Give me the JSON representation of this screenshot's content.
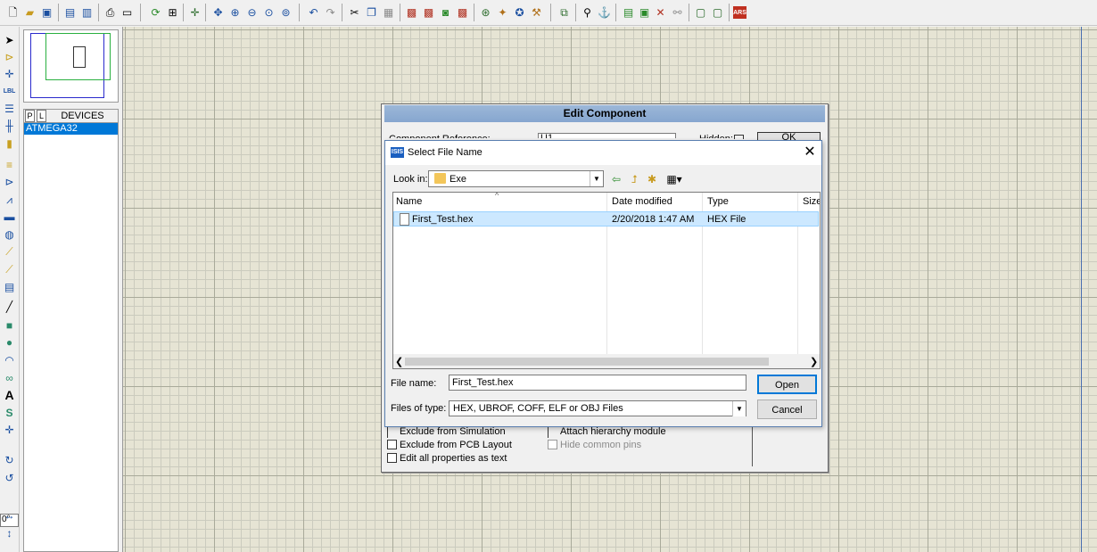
{
  "toolbar": {
    "icons": [
      "new-file-icon",
      "open-folder-icon",
      "save-icon",
      "import-section-icon",
      "export-section-icon",
      "print-icon",
      "print-area-icon",
      "refresh-icon",
      "grid-toggle-icon",
      "origin-icon",
      "pan-icon",
      "zoom-in-icon",
      "zoom-out-icon",
      "zoom-all-icon",
      "zoom-area-icon",
      "undo-icon",
      "redo-icon",
      "cut-icon",
      "copy-icon",
      "paste-icon",
      "block-copy-icon",
      "block-move-icon",
      "block-rotate-icon",
      "block-delete-icon",
      "pick-device-icon",
      "make-device-icon",
      "packaging-tool-icon",
      "decompose-icon",
      "wire-autorouter-icon",
      "search-tag-icon",
      "property-tool-icon",
      "new-sheet-icon",
      "remove-sheet-icon",
      "exit-parent-icon",
      "view-bom-icon",
      "electrical-rules-icon",
      "netlist-to-ares-icon"
    ]
  },
  "left_tools": {
    "icons": [
      "selection-mode-icon",
      "component-mode-icon",
      "junction-dot-icon",
      "wire-label-icon",
      "text-script-icon",
      "buses-icon",
      "subcircuit-icon",
      "terminals-icon",
      "device-pins-icon",
      "graph-icon",
      "tape-recorder-icon",
      "generator-icon",
      "voltage-probe-icon",
      "current-probe-icon",
      "virtual-instruments-icon",
      "line-icon",
      "box-icon",
      "circle-icon",
      "arc-icon",
      "closed-path-icon",
      "text-icon",
      "symbol-icon",
      "marker-icon",
      "rotate-cw-icon",
      "rotate-ccw-icon",
      "mirror-x-icon",
      "mirror-y-icon"
    ],
    "angle_value": "0°"
  },
  "devices": {
    "tab_p": "P",
    "tab_l": "L",
    "title": "DEVICES",
    "items": [
      "ATMEGA32"
    ]
  },
  "edit_component": {
    "title": "Edit Component",
    "ref_label": "Component Reference:",
    "ref_value": "U1",
    "hidden_label": "Hidden:",
    "ok_label": "OK",
    "exclude_sim": "Exclude from Simulation",
    "exclude_pcb": "Exclude from PCB Layout",
    "edit_props": "Edit all properties as text",
    "attach_hier": "Attach hierarchy module",
    "hide_pins": "Hide common pins"
  },
  "select_file": {
    "title": "Select File Name",
    "look_in_label": "Look in:",
    "look_in_value": "Exe",
    "columns": {
      "name": "Name",
      "date": "Date modified",
      "type": "Type",
      "size": "Size"
    },
    "files": [
      {
        "name": "First_Test.hex",
        "date": "2/20/2018 1:47 AM",
        "type": "HEX File"
      }
    ],
    "file_name_label": "File name:",
    "file_name_value": "First_Test.hex",
    "file_type_label": "Files of type:",
    "file_type_value": "HEX, UBROF, COFF, ELF or OBJ Files",
    "open_label": "Open",
    "cancel_label": "Cancel"
  }
}
